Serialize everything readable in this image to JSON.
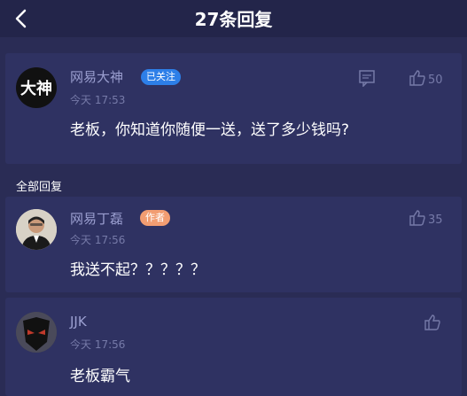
{
  "header": {
    "title": "27条回复"
  },
  "main_post": {
    "avatar_text": "大神",
    "user": "网易大神",
    "badge": "已关注",
    "time": "今天 17:53",
    "content": "老板，你知道你随便一送，送了多少钱吗?",
    "likes": "50"
  },
  "section": {
    "label": "全部回复"
  },
  "replies": [
    {
      "user": "网易丁磊",
      "badge": "作者",
      "time": "今天 17:56",
      "content": "我送不起？？？？？",
      "likes": "35"
    },
    {
      "user": "JJK",
      "time": "今天 17:56",
      "content": "老板霸气",
      "likes": ""
    }
  ],
  "colors": {
    "background": "#2a2c55",
    "card": "#2f3262",
    "accent": "#2d7fe8"
  }
}
